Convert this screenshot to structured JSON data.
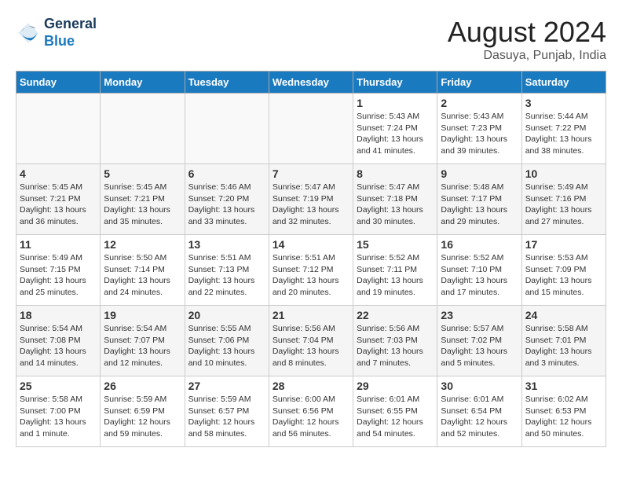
{
  "logo": {
    "line1": "General",
    "line2": "Blue"
  },
  "title": "August 2024",
  "subtitle": "Dasuya, Punjab, India",
  "days_of_week": [
    "Sunday",
    "Monday",
    "Tuesday",
    "Wednesday",
    "Thursday",
    "Friday",
    "Saturday"
  ],
  "weeks": [
    [
      {
        "num": "",
        "info": ""
      },
      {
        "num": "",
        "info": ""
      },
      {
        "num": "",
        "info": ""
      },
      {
        "num": "",
        "info": ""
      },
      {
        "num": "1",
        "info": "Sunrise: 5:43 AM\nSunset: 7:24 PM\nDaylight: 13 hours\nand 41 minutes."
      },
      {
        "num": "2",
        "info": "Sunrise: 5:43 AM\nSunset: 7:23 PM\nDaylight: 13 hours\nand 39 minutes."
      },
      {
        "num": "3",
        "info": "Sunrise: 5:44 AM\nSunset: 7:22 PM\nDaylight: 13 hours\nand 38 minutes."
      }
    ],
    [
      {
        "num": "4",
        "info": "Sunrise: 5:45 AM\nSunset: 7:21 PM\nDaylight: 13 hours\nand 36 minutes."
      },
      {
        "num": "5",
        "info": "Sunrise: 5:45 AM\nSunset: 7:21 PM\nDaylight: 13 hours\nand 35 minutes."
      },
      {
        "num": "6",
        "info": "Sunrise: 5:46 AM\nSunset: 7:20 PM\nDaylight: 13 hours\nand 33 minutes."
      },
      {
        "num": "7",
        "info": "Sunrise: 5:47 AM\nSunset: 7:19 PM\nDaylight: 13 hours\nand 32 minutes."
      },
      {
        "num": "8",
        "info": "Sunrise: 5:47 AM\nSunset: 7:18 PM\nDaylight: 13 hours\nand 30 minutes."
      },
      {
        "num": "9",
        "info": "Sunrise: 5:48 AM\nSunset: 7:17 PM\nDaylight: 13 hours\nand 29 minutes."
      },
      {
        "num": "10",
        "info": "Sunrise: 5:49 AM\nSunset: 7:16 PM\nDaylight: 13 hours\nand 27 minutes."
      }
    ],
    [
      {
        "num": "11",
        "info": "Sunrise: 5:49 AM\nSunset: 7:15 PM\nDaylight: 13 hours\nand 25 minutes."
      },
      {
        "num": "12",
        "info": "Sunrise: 5:50 AM\nSunset: 7:14 PM\nDaylight: 13 hours\nand 24 minutes."
      },
      {
        "num": "13",
        "info": "Sunrise: 5:51 AM\nSunset: 7:13 PM\nDaylight: 13 hours\nand 22 minutes."
      },
      {
        "num": "14",
        "info": "Sunrise: 5:51 AM\nSunset: 7:12 PM\nDaylight: 13 hours\nand 20 minutes."
      },
      {
        "num": "15",
        "info": "Sunrise: 5:52 AM\nSunset: 7:11 PM\nDaylight: 13 hours\nand 19 minutes."
      },
      {
        "num": "16",
        "info": "Sunrise: 5:52 AM\nSunset: 7:10 PM\nDaylight: 13 hours\nand 17 minutes."
      },
      {
        "num": "17",
        "info": "Sunrise: 5:53 AM\nSunset: 7:09 PM\nDaylight: 13 hours\nand 15 minutes."
      }
    ],
    [
      {
        "num": "18",
        "info": "Sunrise: 5:54 AM\nSunset: 7:08 PM\nDaylight: 13 hours\nand 14 minutes."
      },
      {
        "num": "19",
        "info": "Sunrise: 5:54 AM\nSunset: 7:07 PM\nDaylight: 13 hours\nand 12 minutes."
      },
      {
        "num": "20",
        "info": "Sunrise: 5:55 AM\nSunset: 7:06 PM\nDaylight: 13 hours\nand 10 minutes."
      },
      {
        "num": "21",
        "info": "Sunrise: 5:56 AM\nSunset: 7:04 PM\nDaylight: 13 hours\nand 8 minutes."
      },
      {
        "num": "22",
        "info": "Sunrise: 5:56 AM\nSunset: 7:03 PM\nDaylight: 13 hours\nand 7 minutes."
      },
      {
        "num": "23",
        "info": "Sunrise: 5:57 AM\nSunset: 7:02 PM\nDaylight: 13 hours\nand 5 minutes."
      },
      {
        "num": "24",
        "info": "Sunrise: 5:58 AM\nSunset: 7:01 PM\nDaylight: 13 hours\nand 3 minutes."
      }
    ],
    [
      {
        "num": "25",
        "info": "Sunrise: 5:58 AM\nSunset: 7:00 PM\nDaylight: 13 hours\nand 1 minute."
      },
      {
        "num": "26",
        "info": "Sunrise: 5:59 AM\nSunset: 6:59 PM\nDaylight: 12 hours\nand 59 minutes."
      },
      {
        "num": "27",
        "info": "Sunrise: 5:59 AM\nSunset: 6:57 PM\nDaylight: 12 hours\nand 58 minutes."
      },
      {
        "num": "28",
        "info": "Sunrise: 6:00 AM\nSunset: 6:56 PM\nDaylight: 12 hours\nand 56 minutes."
      },
      {
        "num": "29",
        "info": "Sunrise: 6:01 AM\nSunset: 6:55 PM\nDaylight: 12 hours\nand 54 minutes."
      },
      {
        "num": "30",
        "info": "Sunrise: 6:01 AM\nSunset: 6:54 PM\nDaylight: 12 hours\nand 52 minutes."
      },
      {
        "num": "31",
        "info": "Sunrise: 6:02 AM\nSunset: 6:53 PM\nDaylight: 12 hours\nand 50 minutes."
      }
    ]
  ]
}
